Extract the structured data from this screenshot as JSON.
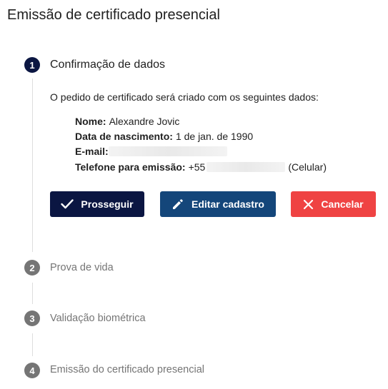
{
  "title": "Emissão de certificado presencial",
  "steps": [
    {
      "number": "1",
      "label": "Confirmação de dados"
    },
    {
      "number": "2",
      "label": "Prova de vida"
    },
    {
      "number": "3",
      "label": "Validação biométrica"
    },
    {
      "number": "4",
      "label": "Emissão do certificado presencial"
    }
  ],
  "intro": "O pedido de certificado será criado com os seguintes dados:",
  "fields": {
    "name_label": "Nome:",
    "name_value": "Alexandre Jovic",
    "birth_label": "Data de nascimento:",
    "birth_value": "1 de jan. de 1990",
    "email_label": "E-mail:",
    "phone_label": "Telefone para emissão:",
    "phone_prefix": "+55",
    "phone_type": "(Celular)"
  },
  "buttons": {
    "proceed": "Prosseguir",
    "edit": "Editar cadastro",
    "cancel": "Cancelar"
  },
  "colors": {
    "proceed": "#0b1642",
    "edit": "#14467a",
    "cancel": "#ef4343",
    "active_step": "#0b1642",
    "inactive_step": "#757575"
  },
  "icons": {
    "proceed": "check-icon",
    "edit": "pencil-icon",
    "cancel": "close-icon"
  }
}
